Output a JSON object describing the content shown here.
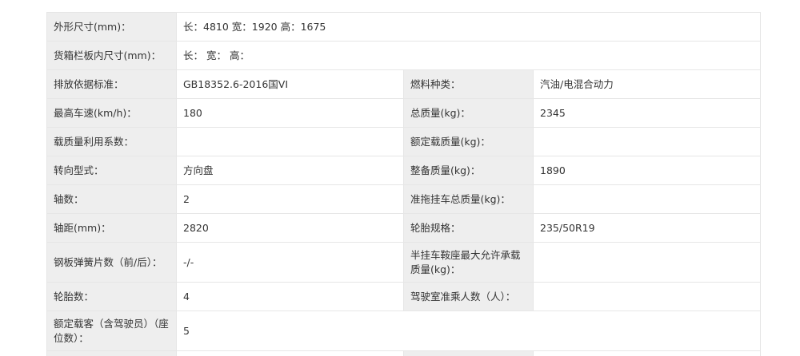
{
  "rows": [
    {
      "label": "外形尺寸(mm)：",
      "value": "长：4810 宽：1920 高：1675"
    },
    {
      "label": "货箱栏板内尺寸(mm)：",
      "value": "长： 宽： 高："
    },
    {
      "label": "排放依据标准：",
      "value": "GB18352.6-2016国VI",
      "label2": "燃料种类：",
      "value2": "汽油/电混合动力"
    },
    {
      "label": "最高车速(km/h)：",
      "value": "180",
      "label2": "总质量(kg)：",
      "value2": "2345"
    },
    {
      "label": "载质量利用系数：",
      "value": "",
      "label2": "额定载质量(kg)：",
      "value2": ""
    },
    {
      "label": "转向型式：",
      "value": "方向盘",
      "label2": "整备质量(kg)：",
      "value2": "1890"
    },
    {
      "label": "轴数：",
      "value": "2",
      "label2": "准拖挂车总质量(kg)：",
      "value2": ""
    },
    {
      "label": "轴距(mm)：",
      "value": "2820",
      "label2": "轮胎规格：",
      "value2": "235/50R19"
    },
    {
      "label": "钢板弹簧片数（前/后）：",
      "value": "-/-",
      "label2": "半挂车鞍座最大允许承载质量(kg)：",
      "value2": ""
    },
    {
      "label": "轮胎数：",
      "value": "4",
      "label2": "驾驶室准乘人数（人）：",
      "value2": ""
    },
    {
      "label": "额定载客（含驾驶员）（座位数）：",
      "value": "5"
    }
  ]
}
